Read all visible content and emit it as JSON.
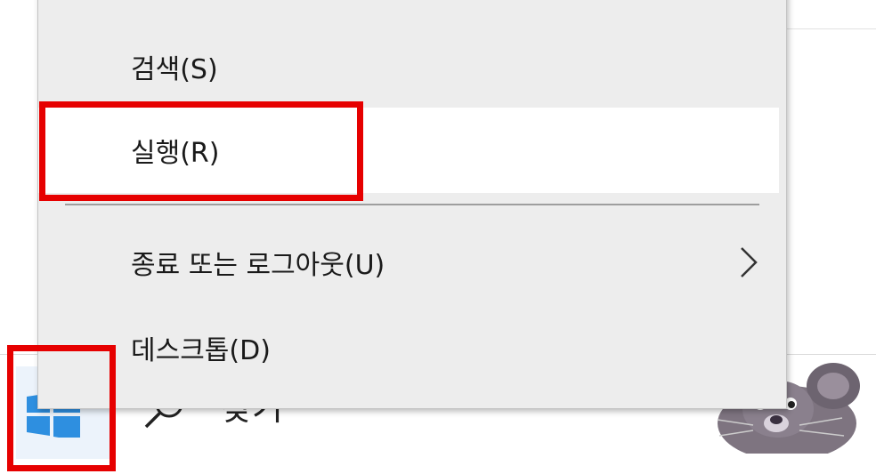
{
  "context_menu": {
    "items": [
      {
        "label": "검색(S)",
        "has_submenu": false,
        "highlighted": false
      },
      {
        "label": "실행(R)",
        "has_submenu": false,
        "highlighted": true
      },
      {
        "label": "종료 또는 로그아웃(U)",
        "has_submenu": true,
        "highlighted": false
      },
      {
        "label": "데스크톱(D)",
        "has_submenu": false,
        "highlighted": false
      }
    ],
    "submenu_icon": "chevron-right-icon"
  },
  "taskbar": {
    "start_icon": "windows-logo-icon",
    "search_icon": "search-icon",
    "search_label": "찾기"
  },
  "annotations": {
    "highlight_color": "#e60000",
    "highlighted_targets": [
      "run-menu-item",
      "start-button"
    ]
  },
  "colors": {
    "menu_background": "#ededed",
    "hover_item_background": "#ffffff",
    "windows_blue": "#2e8fe0"
  }
}
